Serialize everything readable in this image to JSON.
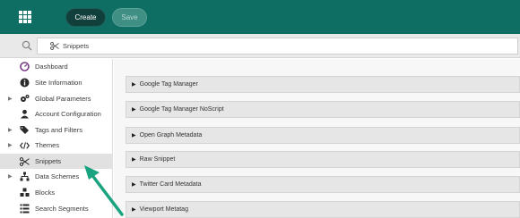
{
  "toolbar": {
    "create_label": "Create",
    "save_label": "Save"
  },
  "breadcrumb": {
    "label": "Snippets"
  },
  "sidebar": {
    "items": [
      {
        "label": "Dashboard",
        "icon": "dashboard-icon",
        "expandable": false
      },
      {
        "label": "Site Information",
        "icon": "info-icon",
        "expandable": false
      },
      {
        "label": "Global Parameters",
        "icon": "gears-icon",
        "expandable": true
      },
      {
        "label": "Account Configuration",
        "icon": "user-icon",
        "expandable": false
      },
      {
        "label": "Tags and Filters",
        "icon": "tags-icon",
        "expandable": true
      },
      {
        "label": "Themes",
        "icon": "code-icon",
        "expandable": true
      },
      {
        "label": "Snippets",
        "icon": "scissors-icon",
        "expandable": false,
        "active": true
      },
      {
        "label": "Data Schemes",
        "icon": "sitemap-icon",
        "expandable": true
      },
      {
        "label": "Blocks",
        "icon": "cubes-icon",
        "expandable": false
      },
      {
        "label": "Search Segments",
        "icon": "list-icon",
        "expandable": false
      }
    ]
  },
  "panels": [
    {
      "label": "Google Tag Manager"
    },
    {
      "label": "Google Tag Manager NoScript"
    },
    {
      "label": "Open Graph Metadata"
    },
    {
      "label": "Raw Snippet"
    },
    {
      "label": "Twitter Card Metadata"
    },
    {
      "label": "Viewport Metatag"
    }
  ],
  "colors": {
    "topbar": "#0f6e63",
    "annotation_arrow": "#19a37f"
  }
}
